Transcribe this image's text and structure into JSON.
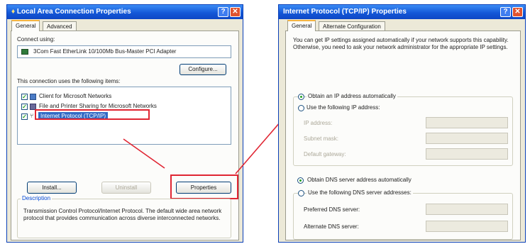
{
  "left_dialog": {
    "title": "Local Area Connection Properties",
    "tabs": [
      "General",
      "Advanced"
    ],
    "connect_using_label": "Connect using:",
    "adapter_name": "3Com Fast EtherLink 10/100Mb Bus-Master PCI Adapter",
    "configure_button": "Configure...",
    "items_label": "This connection uses the following items:",
    "items": [
      {
        "label": "Client for Microsoft Networks",
        "checked": true,
        "selected": false
      },
      {
        "label": "File and Printer Sharing for Microsoft Networks",
        "checked": true,
        "selected": false
      },
      {
        "label": "Internet Protocol (TCP/IP)",
        "checked": true,
        "selected": true
      }
    ],
    "install_button": "Install...",
    "uninstall_button": "Uninstall",
    "properties_button": "Properties",
    "description_label": "Description",
    "description_text": "Transmission Control Protocol/Internet Protocol. The default wide area network protocol that provides communication across diverse interconnected networks."
  },
  "right_dialog": {
    "title": "Internet Protocol (TCP/IP) Properties",
    "tabs": [
      "General",
      "Alternate Configuration"
    ],
    "intro_text": "You can get IP settings assigned automatically if your network supports this capability. Otherwise, you need to ask your network administrator for the appropriate IP settings.",
    "radio_auto_ip": "Obtain an IP address automatically",
    "radio_manual_ip": "Use the following IP address:",
    "ip_address_label": "IP address:",
    "subnet_mask_label": "Subnet mask:",
    "default_gateway_label": "Default gateway:",
    "radio_auto_dns": "Obtain DNS server address automatically",
    "radio_manual_dns": "Use the following DNS server addresses:",
    "preferred_dns_label": "Preferred DNS server:",
    "alternate_dns_label": "Alternate DNS server:"
  },
  "colors": {
    "highlight": "#e02633",
    "titlebar": "#1458d8",
    "dialog_bg": "#ece9d8"
  }
}
